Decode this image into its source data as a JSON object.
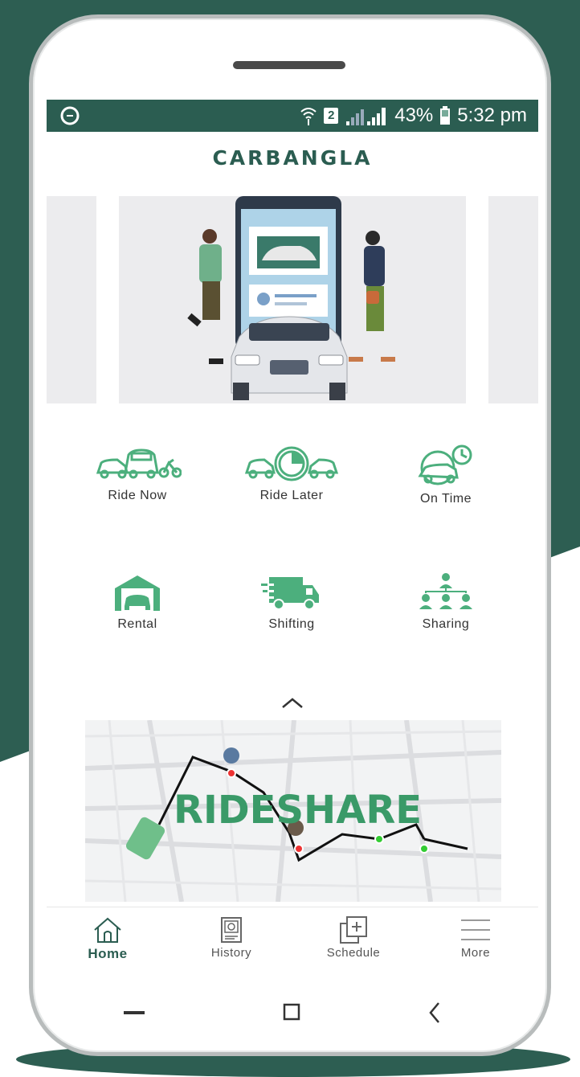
{
  "status_bar": {
    "battery": "43%",
    "time": "5:32 pm",
    "sim": "2"
  },
  "app": {
    "brand": "CARBANGLA"
  },
  "services": [
    {
      "label": "Ride Now",
      "icon": "ride-now-icon"
    },
    {
      "label": "Ride Later",
      "icon": "ride-later-icon"
    },
    {
      "label": "On Time",
      "icon": "on-time-icon"
    },
    {
      "label": "Rental",
      "icon": "rental-garage-icon"
    },
    {
      "label": "Shifting",
      "icon": "shifting-truck-icon"
    },
    {
      "label": "Sharing",
      "icon": "sharing-network-icon"
    }
  ],
  "promo": {
    "title": "RIDESHARE"
  },
  "bottom_nav": {
    "items": [
      {
        "label": "Home",
        "icon": "home-icon",
        "active": true
      },
      {
        "label": "History",
        "icon": "history-icon",
        "active": false
      },
      {
        "label": "Schedule",
        "icon": "schedule-icon",
        "active": false
      },
      {
        "label": "More",
        "icon": "menu-icon",
        "active": false
      }
    ]
  },
  "colors": {
    "brand_dark": "#2b5d51",
    "accent_green": "#4caf7d",
    "background_green": "#2d5e52"
  }
}
